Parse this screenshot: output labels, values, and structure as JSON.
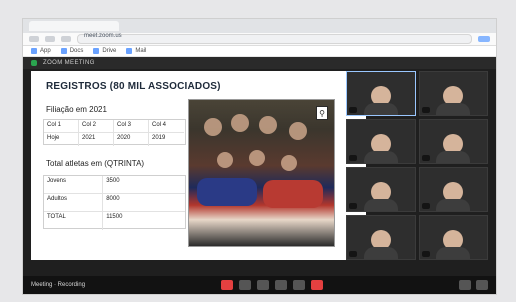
{
  "browser": {
    "url_text": "meet.zoom.us",
    "bookmarks": [
      "App",
      "Docs",
      "Drive",
      "Mail"
    ]
  },
  "zoom": {
    "header_title": "ZOOM MEETING",
    "toolbar_left": "Meeting · Recording"
  },
  "slide": {
    "title": "REGISTROS (80 MIL ASSOCIADOS)",
    "section1": "Filiação em 2021",
    "table1": {
      "headers": [
        "Col 1",
        "Col 2",
        "Col 3",
        "Col 4"
      ],
      "row": [
        "Hoje",
        "2021",
        "2020",
        "2019"
      ]
    },
    "section2": "Total atletas em (QTRINTA)",
    "table2": [
      {
        "label": "Jovens",
        "value": "3500"
      },
      {
        "label": "Adultos",
        "value": "8000"
      },
      {
        "label": "TOTAL",
        "value": "11500"
      }
    ],
    "photo_badge": "⚲"
  },
  "gallery": {
    "tiles": 8
  },
  "colors": {
    "accent_active": "#9ac7ff",
    "leave_red": "#e44040",
    "zoom_green": "#2aa44f"
  }
}
